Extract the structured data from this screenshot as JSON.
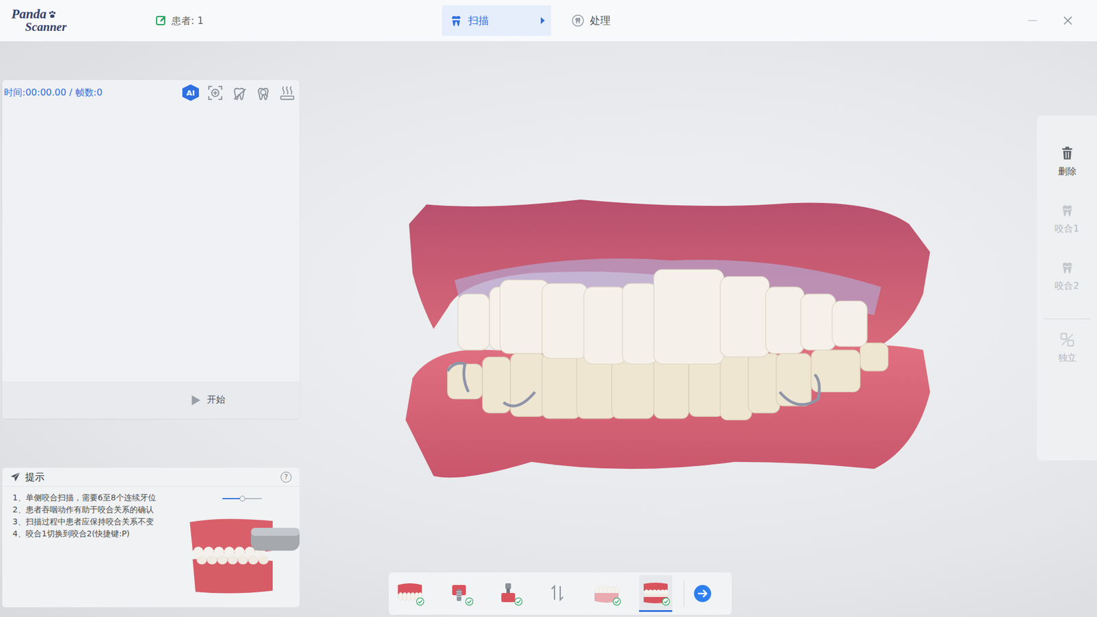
{
  "app": {
    "logo_lines": [
      "Panda",
      "Scanner"
    ]
  },
  "patient": {
    "label": "患者: 1"
  },
  "steps": [
    {
      "kind": "scan",
      "label": "扫描",
      "selected": true
    },
    {
      "kind": "process",
      "label": "处理",
      "selected": false
    }
  ],
  "scan_panel": {
    "status": "时间:00:00.00 / 帧数:0",
    "tools": [
      {
        "kind": "ai",
        "label": "AI",
        "active": true
      },
      {
        "kind": "region",
        "active": false
      },
      {
        "kind": "tooth-erase",
        "active": false
      },
      {
        "kind": "tooth-search",
        "active": false
      },
      {
        "kind": "heat",
        "active": false
      }
    ],
    "start_label": "开始"
  },
  "tips": {
    "title": "提示",
    "help": "?",
    "items": [
      "1、单侧咬合扫描，需要6至8个连续牙位",
      "2、患者吞咽动作有助于咬合关系的确认",
      "3、扫描过程中患者应保持咬合关系不变",
      "4、咬合1切换到咬合2(快捷键:P)"
    ],
    "slider_level": 0.5
  },
  "side_tools": [
    {
      "kind": "delete",
      "label": "删除",
      "disabled": false
    },
    {
      "kind": "bite",
      "label": "咬合1",
      "disabled": true
    },
    {
      "kind": "bite",
      "label": "咬合2",
      "disabled": true
    },
    {
      "kind": "separate",
      "label": "独立",
      "disabled": true
    }
  ],
  "scan_steps": [
    {
      "kind": "upper-jaw",
      "done": true,
      "selected": false
    },
    {
      "kind": "upper-implant",
      "done": true,
      "selected": false
    },
    {
      "kind": "lower-implant",
      "done": true,
      "selected": false
    },
    {
      "kind": "swap",
      "done": false,
      "selected": false
    },
    {
      "kind": "lower-jaw",
      "done": true,
      "selected": false
    },
    {
      "kind": "bite",
      "done": true,
      "selected": true
    }
  ]
}
